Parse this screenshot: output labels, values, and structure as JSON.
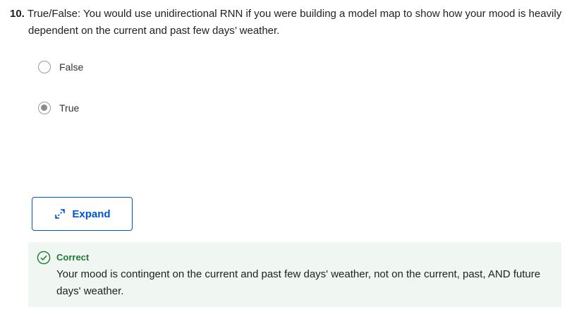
{
  "question": {
    "number": "10.",
    "text": "True/False: You would use unidirectional RNN if you were building a model map to show how your mood is heavily dependent on the current and past few days’ weather."
  },
  "options": [
    {
      "label": "False",
      "selected": false
    },
    {
      "label": "True",
      "selected": true
    }
  ],
  "expand_button": {
    "label": "Expand",
    "icon": "expand-arrows-icon"
  },
  "feedback": {
    "status": "Correct",
    "icon": "check-circle-icon",
    "text": "Your mood is contingent on the current and past few days' weather, not on the current, past, AND future days' weather."
  },
  "colors": {
    "accent": "#0056d2",
    "success": "#1e7a38",
    "feedback_bg": "#f0f6f1"
  }
}
